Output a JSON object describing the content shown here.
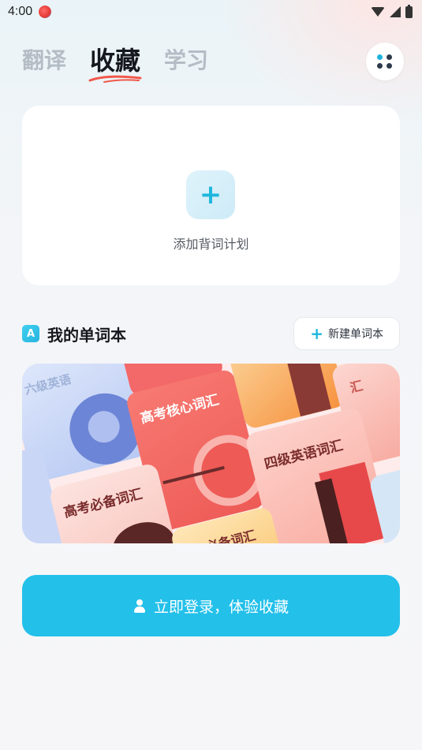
{
  "status_bar": {
    "time": "4:00"
  },
  "tabs": [
    {
      "label": "翻译",
      "active": false
    },
    {
      "label": "收藏",
      "active": true
    },
    {
      "label": "学习",
      "active": false
    }
  ],
  "plan_card": {
    "add_icon": "+",
    "label": "添加背词计划"
  },
  "wordbooks": {
    "badge": "A",
    "title": "我的单词本",
    "new_button": {
      "icon": "+",
      "label": "新建单词本"
    }
  },
  "banner_books": [
    {
      "label": "高考核心词汇"
    },
    {
      "label": "四级英语词汇"
    },
    {
      "label": "高考必备词汇"
    },
    {
      "label": "六级英语"
    },
    {
      "label": "必备词汇"
    },
    {
      "label": "汇"
    }
  ],
  "login": {
    "label": "立即登录，体验收藏"
  },
  "colors": {
    "accent": "#23c0ea",
    "tab_active": "#15181e",
    "tab_inactive": "#b4bcc5",
    "underline": "#f0584a",
    "book_red": "#f36868",
    "book_pink": "#fbbdb6",
    "book_blue": "#c4d3f5",
    "book_orange": "#f99a52"
  }
}
